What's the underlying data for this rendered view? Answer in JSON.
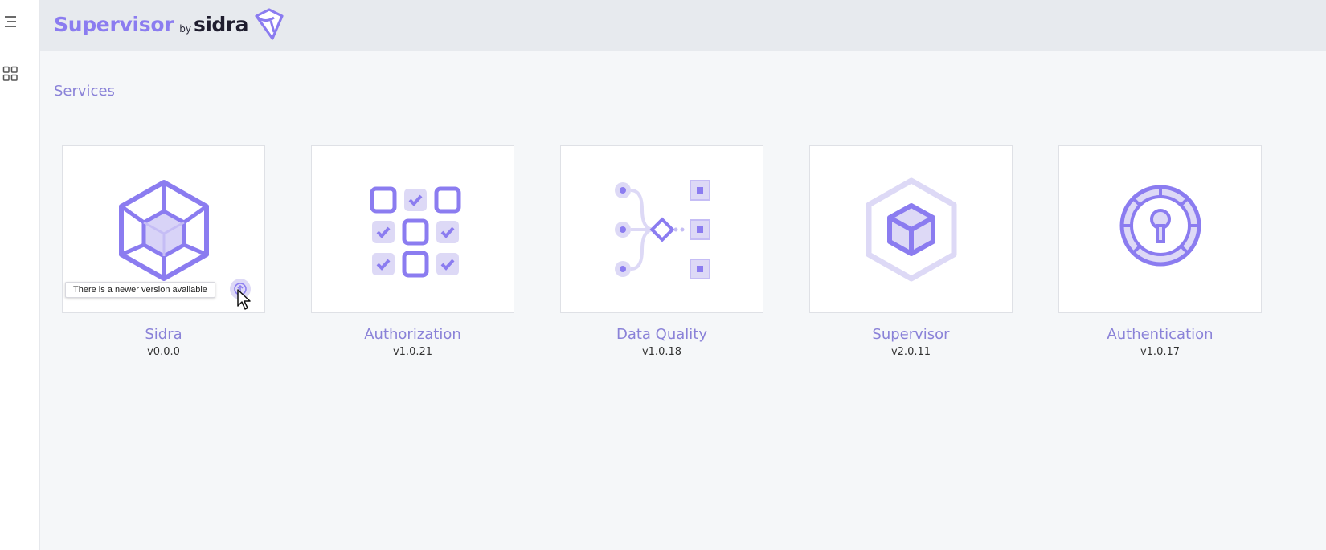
{
  "app": {
    "brand_main": "Supervisor",
    "brand_by": "by",
    "brand_sidra": "sidra"
  },
  "sidebar": {
    "icons": [
      "menu-icon",
      "apps-grid-icon"
    ]
  },
  "page": {
    "title": "Services"
  },
  "services": [
    {
      "name": "Sidra",
      "version": "v0.0.0",
      "icon": "cube-icon",
      "update_tooltip": "There is a newer version available"
    },
    {
      "name": "Authorization",
      "version": "v1.0.21",
      "icon": "checklist-grid-icon"
    },
    {
      "name": "Data Quality",
      "version": "v1.0.18",
      "icon": "data-flow-icon"
    },
    {
      "name": "Supervisor",
      "version": "v2.0.11",
      "icon": "hexagon-cube-icon"
    },
    {
      "name": "Authentication",
      "version": "v1.0.17",
      "icon": "keyhole-icon"
    }
  ],
  "colors": {
    "accent": "#8b7cf0",
    "accent_light": "#ddd9f6",
    "text_label": "#8a82d8",
    "background": "#f5f7f9",
    "header": "#e7eaee"
  }
}
